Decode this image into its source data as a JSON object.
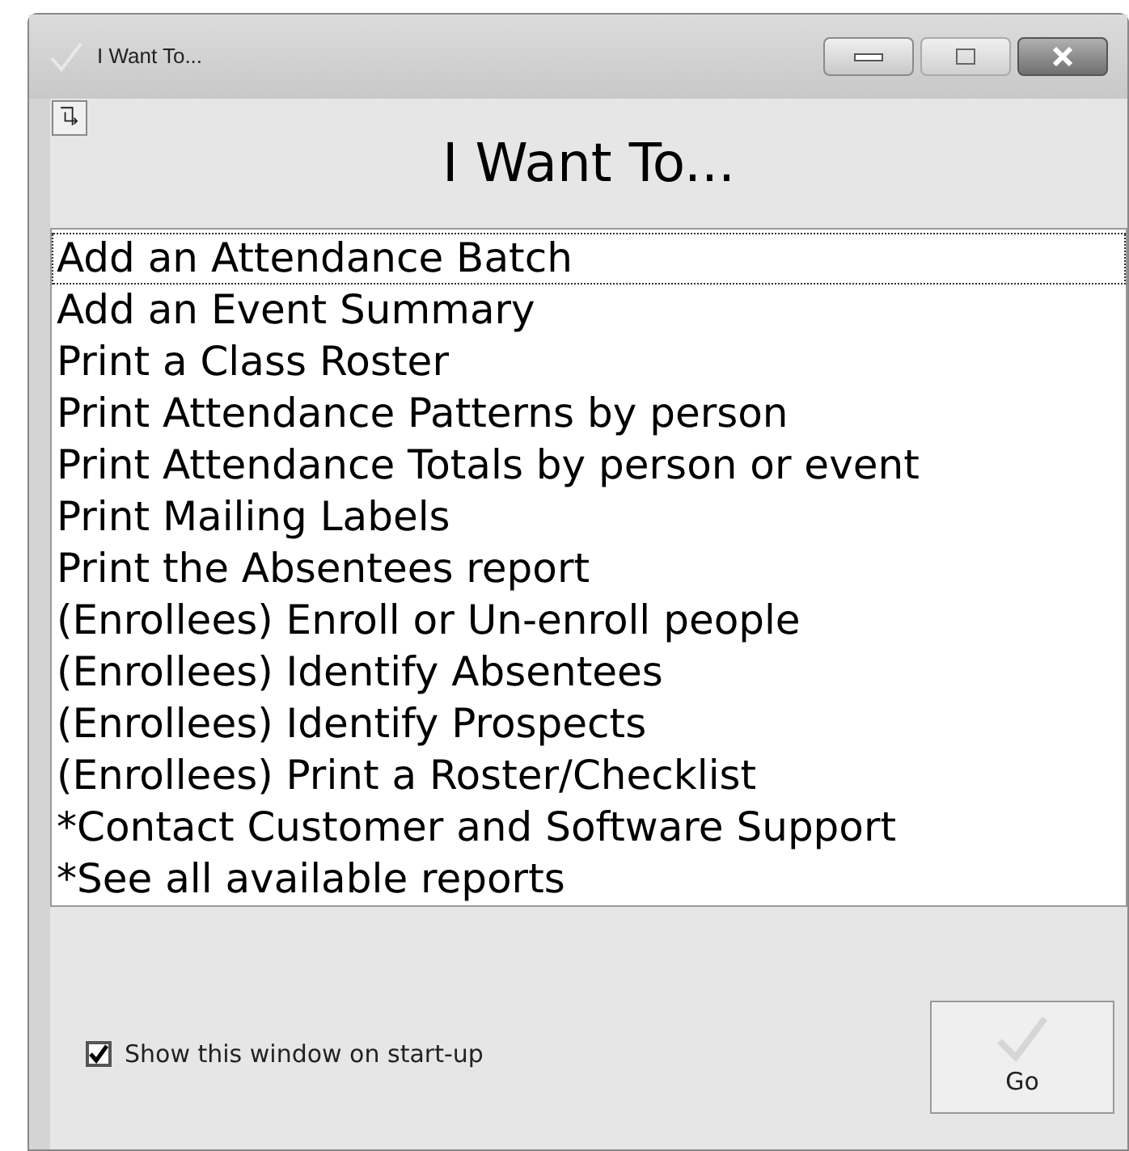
{
  "window": {
    "title": "I Want To..."
  },
  "heading": "I Want To...",
  "items": [
    {
      "label": "Add an Attendance Batch",
      "selected": true
    },
    {
      "label": "Add an Event Summary",
      "selected": false
    },
    {
      "label": "Print a Class Roster",
      "selected": false
    },
    {
      "label": "Print Attendance Patterns by person",
      "selected": false
    },
    {
      "label": "Print Attendance Totals by person or event",
      "selected": false
    },
    {
      "label": "Print Mailing Labels",
      "selected": false
    },
    {
      "label": "Print the Absentees report",
      "selected": false
    },
    {
      "label": "(Enrollees) Enroll or Un-enroll people",
      "selected": false
    },
    {
      "label": "(Enrollees) Identify Absentees",
      "selected": false
    },
    {
      "label": "(Enrollees) Identify Prospects",
      "selected": false
    },
    {
      "label": "(Enrollees) Print a Roster/Checklist",
      "selected": false
    },
    {
      "label": "*Contact Customer and Software Support",
      "selected": false
    },
    {
      "label": "*See all available reports",
      "selected": false
    }
  ],
  "startup_checkbox": {
    "label": "Show this window on start-up",
    "checked": true
  },
  "go_button": {
    "label": "Go"
  }
}
